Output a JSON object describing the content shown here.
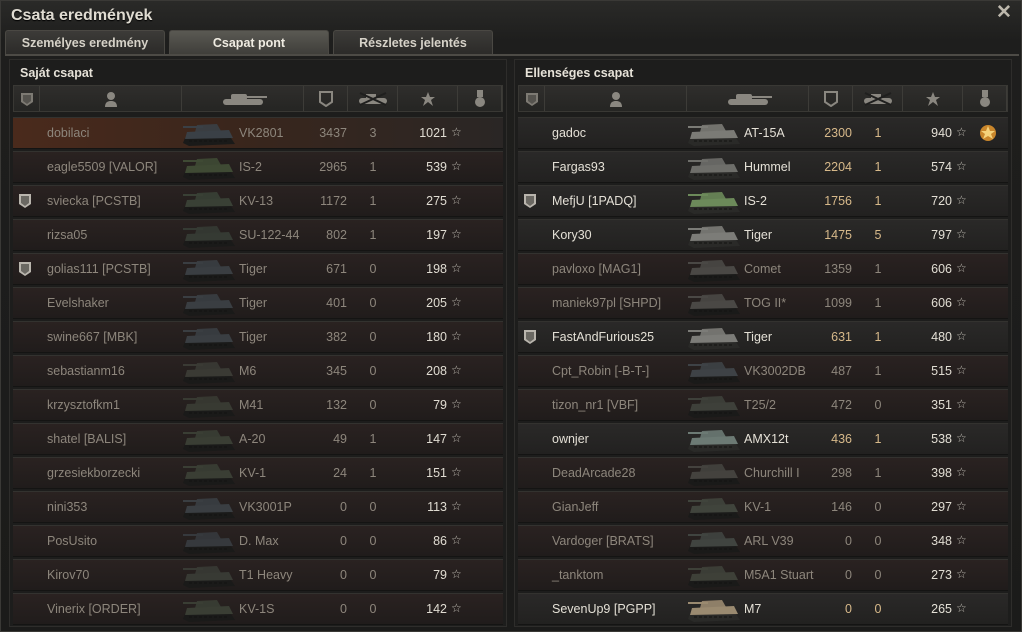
{
  "window": {
    "title": "Csata eredmények",
    "close_icon": "close-icon"
  },
  "tabs": [
    {
      "label": "Személyes eredmény",
      "active": false
    },
    {
      "label": "Csapat pont",
      "active": true
    },
    {
      "label": "Részletes jelentés",
      "active": false
    }
  ],
  "columns_icons": [
    "clan-icon",
    "player-icon",
    "tank-icon",
    "damage-icon",
    "kills-icon",
    "xp-star-icon",
    "medal-icon"
  ],
  "teams": [
    {
      "title": "Saját csapat",
      "rows": [
        {
          "name": "dobilaci",
          "tank": "VK2801",
          "damage": "3437",
          "kills": "3",
          "xp": "1021",
          "clan_badge": false,
          "alive": false,
          "highlight": true,
          "tank_color": "#3a4046"
        },
        {
          "name": "eagle5509 [VALOR]",
          "tank": "IS-2",
          "damage": "2965",
          "kills": "1",
          "xp": "539",
          "clan_badge": false,
          "alive": false,
          "highlight": false,
          "tank_color": "#3f4a34"
        },
        {
          "name": "sviecka [PCSTB]",
          "tank": "KV-13",
          "damage": "1172",
          "kills": "1",
          "xp": "275",
          "clan_badge": true,
          "alive": false,
          "highlight": false,
          "tank_color": "#394035"
        },
        {
          "name": "rizsa05",
          "tank": "SU-122-44",
          "damage": "802",
          "kills": "1",
          "xp": "197",
          "clan_badge": false,
          "alive": false,
          "highlight": false,
          "tank_color": "#353a33"
        },
        {
          "name": "golias111 [PCSTB]",
          "tank": "Tiger",
          "damage": "671",
          "kills": "0",
          "xp": "198",
          "clan_badge": true,
          "alive": false,
          "highlight": false,
          "tank_color": "#3a3e42"
        },
        {
          "name": "Evelshaker",
          "tank": "Tiger",
          "damage": "401",
          "kills": "0",
          "xp": "205",
          "clan_badge": false,
          "alive": false,
          "highlight": false,
          "tank_color": "#3a3e42"
        },
        {
          "name": "swine667 [MBK]",
          "tank": "Tiger",
          "damage": "382",
          "kills": "0",
          "xp": "180",
          "clan_badge": false,
          "alive": false,
          "highlight": false,
          "tank_color": "#3a3e42"
        },
        {
          "name": "sebastianm16",
          "tank": "M6",
          "damage": "345",
          "kills": "0",
          "xp": "208",
          "clan_badge": false,
          "alive": false,
          "highlight": false,
          "tank_color": "#3a3a34"
        },
        {
          "name": "krzysztofkm1",
          "tank": "M41",
          "damage": "132",
          "kills": "0",
          "xp": "79",
          "clan_badge": false,
          "alive": false,
          "highlight": false,
          "tank_color": "#383a32"
        },
        {
          "name": "shatel [BALIS]",
          "tank": "A-20",
          "damage": "49",
          "kills": "1",
          "xp": "147",
          "clan_badge": false,
          "alive": false,
          "highlight": false,
          "tank_color": "#3a3e34"
        },
        {
          "name": "grzesiekborzecki",
          "tank": "KV-1",
          "damage": "24",
          "kills": "1",
          "xp": "151",
          "clan_badge": false,
          "alive": false,
          "highlight": false,
          "tank_color": "#3a3e34"
        },
        {
          "name": "nini353",
          "tank": "VK3001P",
          "damage": "0",
          "kills": "0",
          "xp": "113",
          "clan_badge": false,
          "alive": false,
          "highlight": false,
          "tank_color": "#3a3e42"
        },
        {
          "name": "PosUsito",
          "tank": "D. Max",
          "damage": "0",
          "kills": "0",
          "xp": "86",
          "clan_badge": false,
          "alive": false,
          "highlight": false,
          "tank_color": "#36393d"
        },
        {
          "name": "Kirov70",
          "tank": "T1 Heavy",
          "damage": "0",
          "kills": "0",
          "xp": "79",
          "clan_badge": false,
          "alive": false,
          "highlight": false,
          "tank_color": "#383a34"
        },
        {
          "name": "Vinerix [ORDER]",
          "tank": "KV-1S",
          "damage": "0",
          "kills": "0",
          "xp": "142",
          "clan_badge": false,
          "alive": false,
          "highlight": false,
          "tank_color": "#3a3e34"
        }
      ]
    },
    {
      "title": "Ellenséges csapat",
      "rows": [
        {
          "name": "gadoc",
          "tank": "AT-15A",
          "damage": "2300",
          "kills": "1",
          "xp": "940",
          "clan_badge": false,
          "alive": true,
          "highlight": false,
          "tank_color": "#7b7b76",
          "medal": true
        },
        {
          "name": "Fargas93",
          "tank": "Hummel",
          "damage": "2204",
          "kills": "1",
          "xp": "574",
          "clan_badge": false,
          "alive": true,
          "highlight": false,
          "tank_color": "#6e6e6a"
        },
        {
          "name": "MefjU [1PADQ]",
          "tank": "IS-2",
          "damage": "1756",
          "kills": "1",
          "xp": "720",
          "clan_badge": true,
          "alive": true,
          "highlight": false,
          "tank_color": "#6c8a5a"
        },
        {
          "name": "Kory30",
          "tank": "Tiger",
          "damage": "1475",
          "kills": "5",
          "xp": "797",
          "clan_badge": false,
          "alive": true,
          "highlight": false,
          "tank_color": "#7c7c78"
        },
        {
          "name": "pavloxo [MAG1]",
          "tank": "Comet",
          "damage": "1359",
          "kills": "1",
          "xp": "606",
          "clan_badge": false,
          "alive": false,
          "highlight": false,
          "tank_color": "#4a4845"
        },
        {
          "name": "maniek97pl [SHPD]",
          "tank": "TOG II*",
          "damage": "1099",
          "kills": "1",
          "xp": "606",
          "clan_badge": false,
          "alive": false,
          "highlight": false,
          "tank_color": "#4a4845"
        },
        {
          "name": "FastAndFurious25",
          "tank": "Tiger",
          "damage": "631",
          "kills": "1",
          "xp": "480",
          "clan_badge": true,
          "alive": true,
          "highlight": false,
          "tank_color": "#7c7c78"
        },
        {
          "name": "Cpt_Robin [-B-T-]",
          "tank": "VK3002DB",
          "damage": "487",
          "kills": "1",
          "xp": "515",
          "clan_badge": false,
          "alive": false,
          "highlight": false,
          "tank_color": "#3e4246"
        },
        {
          "name": "tizon_nr1 [VBF]",
          "tank": "T25/2",
          "damage": "472",
          "kills": "0",
          "xp": "351",
          "clan_badge": false,
          "alive": false,
          "highlight": false,
          "tank_color": "#3e403a"
        },
        {
          "name": "ownjer",
          "tank": "AMX12t",
          "damage": "436",
          "kills": "1",
          "xp": "538",
          "clan_badge": false,
          "alive": true,
          "highlight": false,
          "tank_color": "#6c7a74"
        },
        {
          "name": "DeadArcade28",
          "tank": "Churchill I",
          "damage": "298",
          "kills": "1",
          "xp": "398",
          "clan_badge": false,
          "alive": false,
          "highlight": false,
          "tank_color": "#44423e"
        },
        {
          "name": "GianJeff",
          "tank": "KV-1",
          "damage": "146",
          "kills": "0",
          "xp": "297",
          "clan_badge": false,
          "alive": false,
          "highlight": false,
          "tank_color": "#40443c"
        },
        {
          "name": "Vardoger [BRATS]",
          "tank": "ARL V39",
          "damage": "0",
          "kills": "0",
          "xp": "348",
          "clan_badge": false,
          "alive": false,
          "highlight": false,
          "tank_color": "#404440"
        },
        {
          "name": "_tanktom",
          "tank": "M5A1 Stuart",
          "damage": "0",
          "kills": "0",
          "xp": "273",
          "clan_badge": false,
          "alive": false,
          "highlight": false,
          "tank_color": "#3e4038"
        },
        {
          "name": "SevenUp9 [PGPP]",
          "tank": "M7",
          "damage": "0",
          "kills": "0",
          "xp": "265",
          "clan_badge": false,
          "alive": true,
          "highlight": false,
          "tank_color": "#9a8a70"
        }
      ]
    }
  ]
}
